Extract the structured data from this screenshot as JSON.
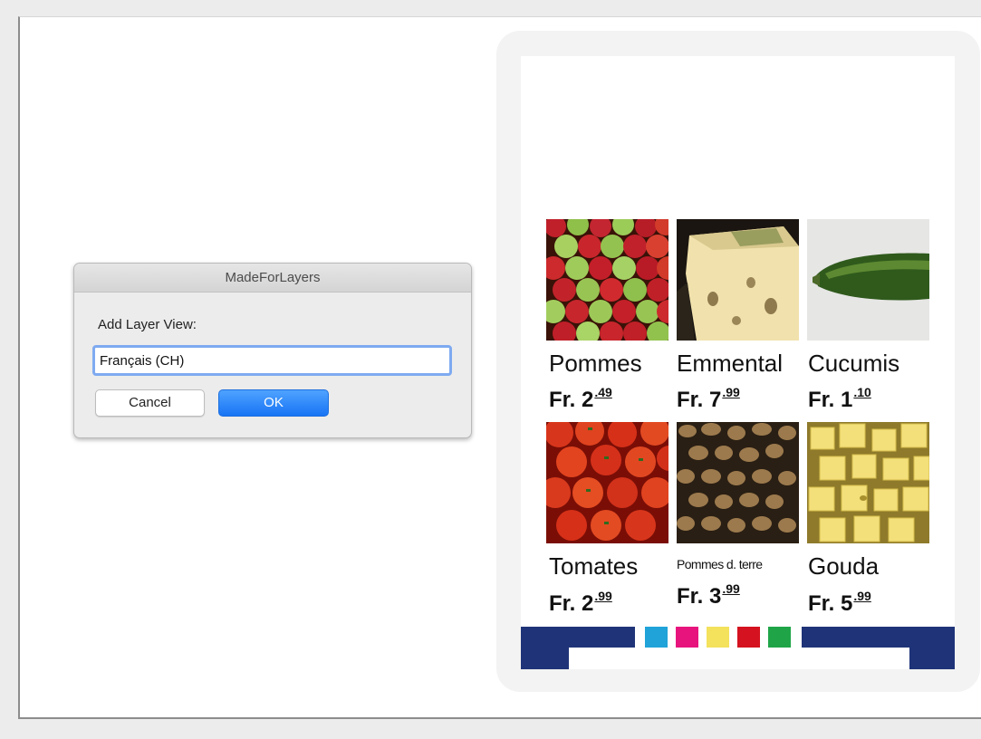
{
  "dialog": {
    "title": "MadeForLayers",
    "label": "Add Layer View:",
    "input_value": "Français (CH)",
    "cancel_label": "Cancel",
    "ok_label": "OK"
  },
  "products": [
    {
      "name": "Pommes",
      "price_main": "Fr. 2",
      "price_cents": ".49",
      "image": "apples"
    },
    {
      "name": "Emmental",
      "price_main": "Fr. 7",
      "price_cents": ".99",
      "image": "emmental-cheese"
    },
    {
      "name": "Cucumis",
      "price_main": "Fr. 1",
      "price_cents": ".10",
      "image": "cucumber"
    },
    {
      "name": "Tomates",
      "price_main": "Fr. 2",
      "price_cents": ".99",
      "image": "tomatoes"
    },
    {
      "name": "Pommes d. terre",
      "price_main": "Fr. 3",
      "price_cents": ".99",
      "image": "potatoes"
    },
    {
      "name": "Gouda",
      "price_main": "Fr. 5",
      "price_cents": ".99",
      "image": "gouda-cheese"
    }
  ],
  "colors": {
    "accent_blue": "#1874f4",
    "bar_navy": "#1f3478",
    "swatches": [
      "#1fa3d8",
      "#e8147e",
      "#f4e15c",
      "#d5121f",
      "#1fa548"
    ]
  }
}
